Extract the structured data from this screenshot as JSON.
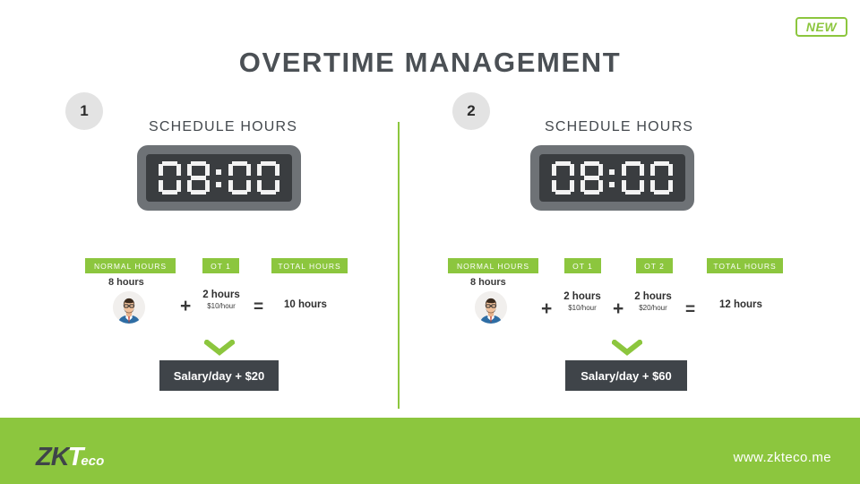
{
  "badge": {
    "label": "NEW"
  },
  "title": "OVERTIME MANAGEMENT",
  "colors": {
    "brand_green": "#8cc63e",
    "dark_slate": "#3f4449",
    "title_gray": "#4b5055",
    "clock_body": "#6e7276",
    "clock_face": "#3a3d40",
    "step_circle": "#e3e3e3"
  },
  "panels": [
    {
      "step": "1",
      "schedule_label": "SCHEDULE HOURS",
      "clock_time": "08:00",
      "tags": [
        "NORMAL HOURS",
        "OT 1",
        "TOTAL HOURS"
      ],
      "normal_hours": "8 hours",
      "avatar_name": "employee-avatar",
      "overtimes": [
        {
          "hours": "2 hours",
          "rate": "$10/hour"
        }
      ],
      "operators": {
        "plus": "+",
        "equals": "="
      },
      "total": "10 hours",
      "salary": "Salary/day + $20"
    },
    {
      "step": "2",
      "schedule_label": "SCHEDULE HOURS",
      "clock_time": "08:00",
      "tags": [
        "NORMAL HOURS",
        "OT 1",
        "OT 2",
        "TOTAL HOURS"
      ],
      "normal_hours": "8 hours",
      "avatar_name": "employee-avatar",
      "overtimes": [
        {
          "hours": "2 hours",
          "rate": "$10/hour"
        },
        {
          "hours": "2 hours",
          "rate": "$20/hour"
        }
      ],
      "operators": {
        "plus": "+",
        "equals": "="
      },
      "total": "12 hours",
      "salary": "Salary/day + $60"
    }
  ],
  "footer": {
    "logo_zk": "ZK",
    "logo_t": "T",
    "logo_eco": "eco",
    "website": "www.zkteco.me"
  }
}
